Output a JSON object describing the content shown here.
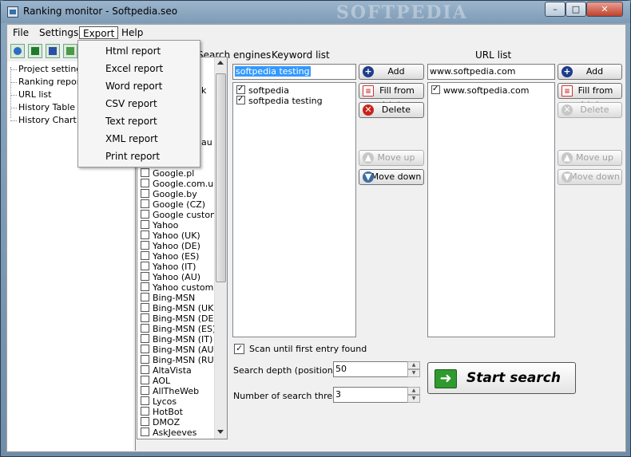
{
  "window": {
    "title": "Ranking monitor - Softpedia.seo",
    "watermark": "SOFTPEDIA",
    "min": "–",
    "max": "□",
    "close": "✕"
  },
  "menubar": {
    "file": "File",
    "settings": "Settings",
    "export": "Export",
    "help": "Help"
  },
  "export_menu": {
    "items": [
      "Html report",
      "Excel report",
      "Word report",
      "CSV report",
      "Text report",
      "XML report",
      "Print report"
    ]
  },
  "toolbar": {
    "icons": [
      "html-report-icon",
      "excel-report-icon",
      "word-report-icon",
      "export-icon"
    ]
  },
  "tree": {
    "items": [
      "Project settings",
      "Ranking report",
      "URL list",
      "History Table",
      "History Chart"
    ]
  },
  "search_engines": {
    "header": "Search engines",
    "visible_partial": [
      "k",
      "au"
    ],
    "items": [
      "Google.pl",
      "Google.com.ua",
      "Google.by",
      "Google (CZ)",
      "Google custom",
      "Yahoo",
      "Yahoo (UK)",
      "Yahoo (DE)",
      "Yahoo (ES)",
      "Yahoo (IT)",
      "Yahoo (AU)",
      "Yahoo custom",
      "Bing-MSN",
      "Bing-MSN (UK)",
      "Bing-MSN (DE)",
      "Bing-MSN (ES)",
      "Bing-MSN (IT)",
      "Bing-MSN (AU)",
      "Bing-MSN (RU)",
      "AltaVista",
      "AOL",
      "AllTheWeb",
      "Lycos",
      "HotBot",
      "DMOZ",
      "AskJeeves"
    ]
  },
  "keywords": {
    "header": "Keyword list",
    "input_value": "softpedia testing",
    "items": [
      "softpedia",
      "softpedia testing"
    ],
    "add": "Add",
    "fill": "Fill from *.txt",
    "delete": "Delete",
    "move_up": "Move up",
    "move_down": "Move down"
  },
  "urls": {
    "header": "URL list",
    "input_value": "www.softpedia.com",
    "items": [
      "www.softpedia.com"
    ],
    "add": "Add",
    "fill": "Fill from *.txt",
    "delete": "Delete",
    "move_up": "Move up",
    "move_down": "Move down"
  },
  "options": {
    "scan_label": "Scan until first entry found",
    "depth_label": "Search depth (positions)",
    "depth_value": "50",
    "threads_label": "Number of search threads",
    "threads_value": "3"
  },
  "start": {
    "label": "Start search"
  }
}
